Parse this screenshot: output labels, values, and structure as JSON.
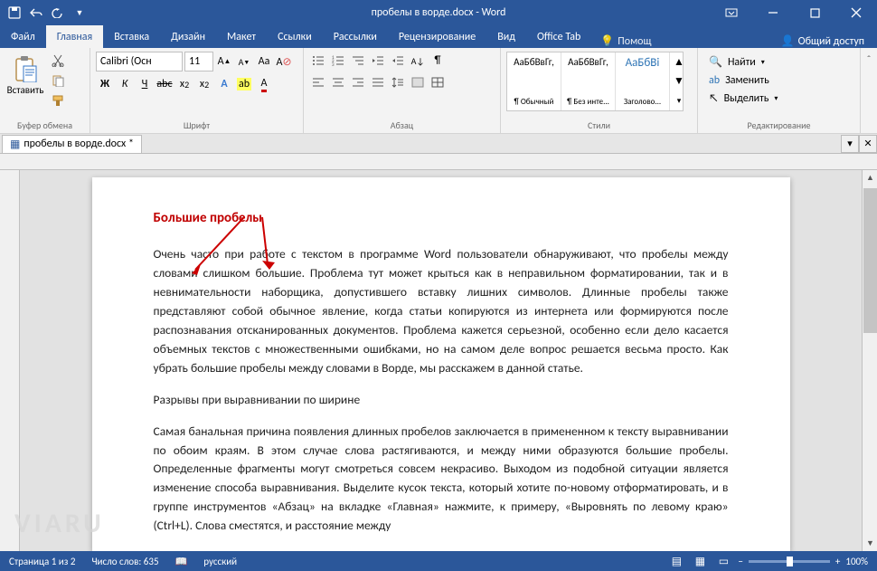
{
  "titlebar": {
    "title": "пробелы в ворде.docx - Word"
  },
  "tabs": {
    "file": "Файл",
    "home": "Главная",
    "insert": "Вставка",
    "design": "Дизайн",
    "layout": "Макет",
    "refs": "Ссылки",
    "mail": "Рассылки",
    "review": "Рецензирование",
    "view": "Вид",
    "office": "Office Tab",
    "tell": "Помощ",
    "share": "Общий доступ"
  },
  "ribbon": {
    "paste": "Вставить",
    "group_clip": "Буфер обмена",
    "group_font": "Шрифт",
    "group_para": "Абзац",
    "group_styles": "Стили",
    "group_edit": "Редактирование",
    "font_name": "Calibri (Осн",
    "font_size": "11",
    "styles": [
      {
        "sample": "АаБбВвГг,",
        "name": "¶ Обычный"
      },
      {
        "sample": "АаБбВвГг,",
        "name": "¶ Без инте..."
      },
      {
        "sample": "АаБбВі",
        "name": "Заголово..."
      }
    ],
    "find": "Найти",
    "replace": "Заменить",
    "select": "Выделить"
  },
  "doc_tab": {
    "name": "пробелы в ворде.docx *"
  },
  "document": {
    "heading": "Большие пробелы",
    "p1": "Очень часто при работе с текстом в программе Word пользователи обнаруживают, что пробелы между словами слишком большие. Проблема тут может крыться как в неправильном форматировании, так и в невнимательности наборщика, допустившего вставку лишних символов. Длинные пробелы также представляют собой обычное явление, когда статьи копируются из интернета или формируются после распознавания отсканированных документов. Проблема кажется серьезной, особенно если дело касается объемных текстов с множественными ошибками, но на самом деле вопрос решается весьма просто. Как убрать большие пробелы между словами в Ворде, мы расскажем в данной статье.",
    "p2": "Разрывы при выравнивании по ширине",
    "p3": "Самая банальная причина появления длинных пробелов заключается в примененном к тексту выравнивании по обоим краям. В этом случае слова растягиваются, и между ними образуются большие пробелы. Определенные фрагменты могут смотреться совсем некрасиво. Выходом из подобной ситуации является изменение способа выравнивания. Выделите кусок текста, который хотите по-новому отформатировать, и в группе инструментов «Абзац» на вкладке «Главная» нажмите, к примеру, «Выровнять по левому краю» (Ctrl+L). Слова сместятся, и расстояние между"
  },
  "status": {
    "page": "Страница 1 из 2",
    "words": "Число слов: 635",
    "lang": "русский",
    "zoom": "100%"
  },
  "watermark": "VIARU"
}
